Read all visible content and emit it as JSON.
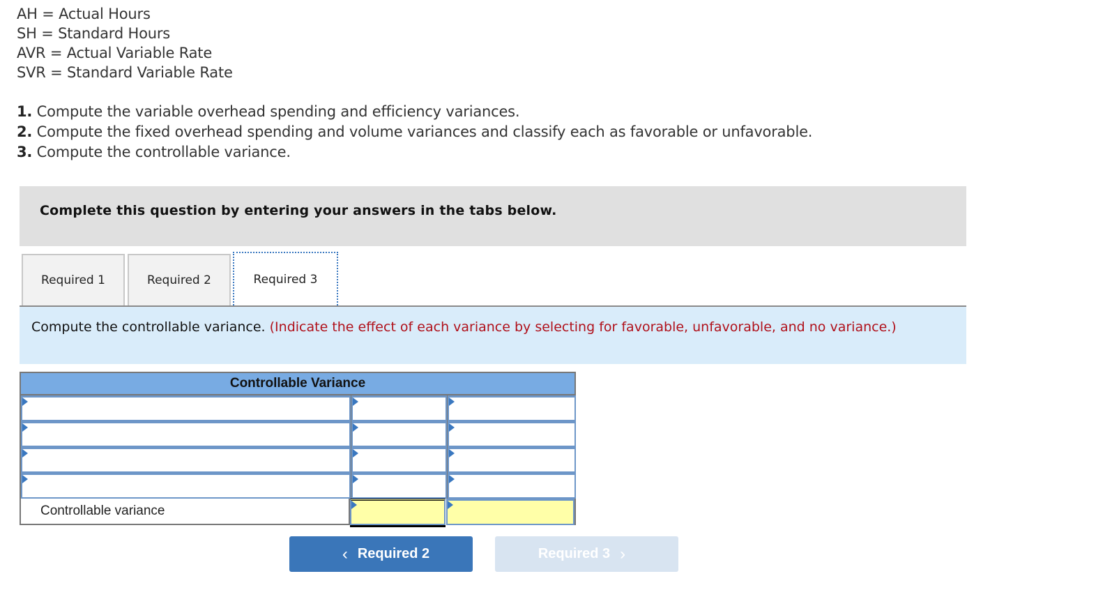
{
  "definitions": [
    "AH = Actual Hours",
    "SH = Standard Hours",
    "AVR = Actual Variable Rate",
    "SVR = Standard Variable Rate"
  ],
  "requirements": [
    {
      "num": "1.",
      "text": " Compute the variable overhead spending and efficiency variances."
    },
    {
      "num": "2.",
      "text": " Compute the fixed overhead spending and volume variances and classify each as favorable or unfavorable."
    },
    {
      "num": "3.",
      "text": " Compute the controllable variance."
    }
  ],
  "instruction": "Complete this question by entering your answers in the tabs below.",
  "tabs": [
    {
      "label": "Required 1",
      "active": false
    },
    {
      "label": "Required 2",
      "active": false
    },
    {
      "label": "Required 3",
      "active": true
    }
  ],
  "prompt": {
    "main": "Compute the controllable variance. ",
    "note": "(Indicate the effect of each variance by selecting for favorable, unfavorable, and no variance.)"
  },
  "table": {
    "header": "Controllable Variance",
    "rows": [
      {
        "label": "",
        "amount": "",
        "effect": ""
      },
      {
        "label": "",
        "amount": "",
        "effect": ""
      },
      {
        "label": "",
        "amount": "",
        "effect": ""
      },
      {
        "label": "",
        "amount": "",
        "effect": ""
      }
    ],
    "total": {
      "label": "Controllable variance",
      "amount": "",
      "effect": ""
    }
  },
  "nav": {
    "prev_label": "Required 2",
    "next_label": "Required 3",
    "prev_icon": "chevron-left-icon",
    "next_icon": "chevron-right-icon"
  },
  "colors": {
    "header_blue": "#78abe3",
    "prompt_bg": "#d9ecfa",
    "note_red": "#b0101a",
    "total_yellow": "#ffffa8",
    "button_blue": "#3a76b9",
    "button_disabled": "#d8e4f1"
  }
}
